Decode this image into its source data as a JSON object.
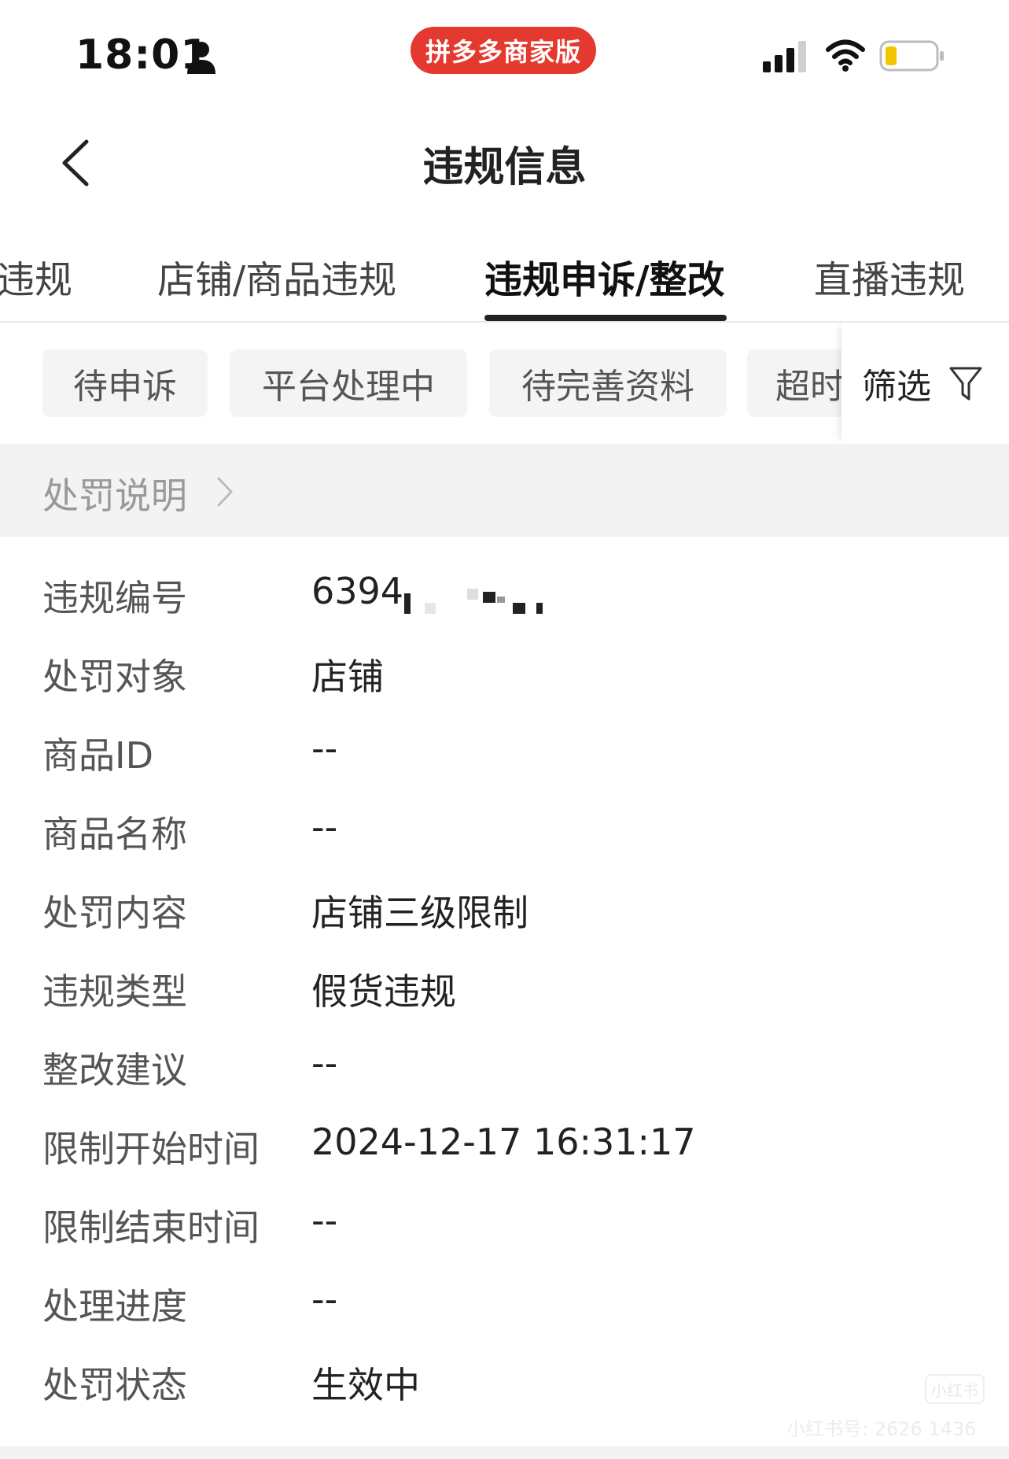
{
  "status_bar": {
    "time": "18:01",
    "app_badge": "拼多多商家版"
  },
  "nav": {
    "title": "违规信息"
  },
  "tabs": [
    {
      "label": "违规"
    },
    {
      "label": "店铺/商品违规"
    },
    {
      "label": "违规申诉/整改",
      "active": true
    },
    {
      "label": "直播违规"
    }
  ],
  "chips": [
    {
      "label": "待申诉"
    },
    {
      "label": "平台处理中"
    },
    {
      "label": "待完善资料"
    },
    {
      "label": "超时"
    }
  ],
  "filter": {
    "label": "筛选",
    "icon": "filter-icon"
  },
  "explain": {
    "label": "处罚说明"
  },
  "info_rows": [
    {
      "label": "违规编号",
      "value": "6394"
    },
    {
      "label": "处罚对象",
      "value": "店铺"
    },
    {
      "label": "商品ID",
      "value": "--"
    },
    {
      "label": "商品名称",
      "value": "--"
    },
    {
      "label": "处罚内容",
      "value": "店铺三级限制"
    },
    {
      "label": "违规类型",
      "value": "假货违规"
    },
    {
      "label": "整改建议",
      "value": "--"
    },
    {
      "label": "限制开始时间",
      "value": "2024-12-17 16:31:17"
    },
    {
      "label": "限制结束时间",
      "value": "--"
    },
    {
      "label": "处理进度",
      "value": "--"
    },
    {
      "label": "处罚状态",
      "value": "生效中"
    }
  ],
  "watermark": {
    "logo": "小红书",
    "text": "小红书号: 2626 1436"
  },
  "colors": {
    "accent_red": "#e3392e",
    "battery_yellow": "#f5c400"
  }
}
